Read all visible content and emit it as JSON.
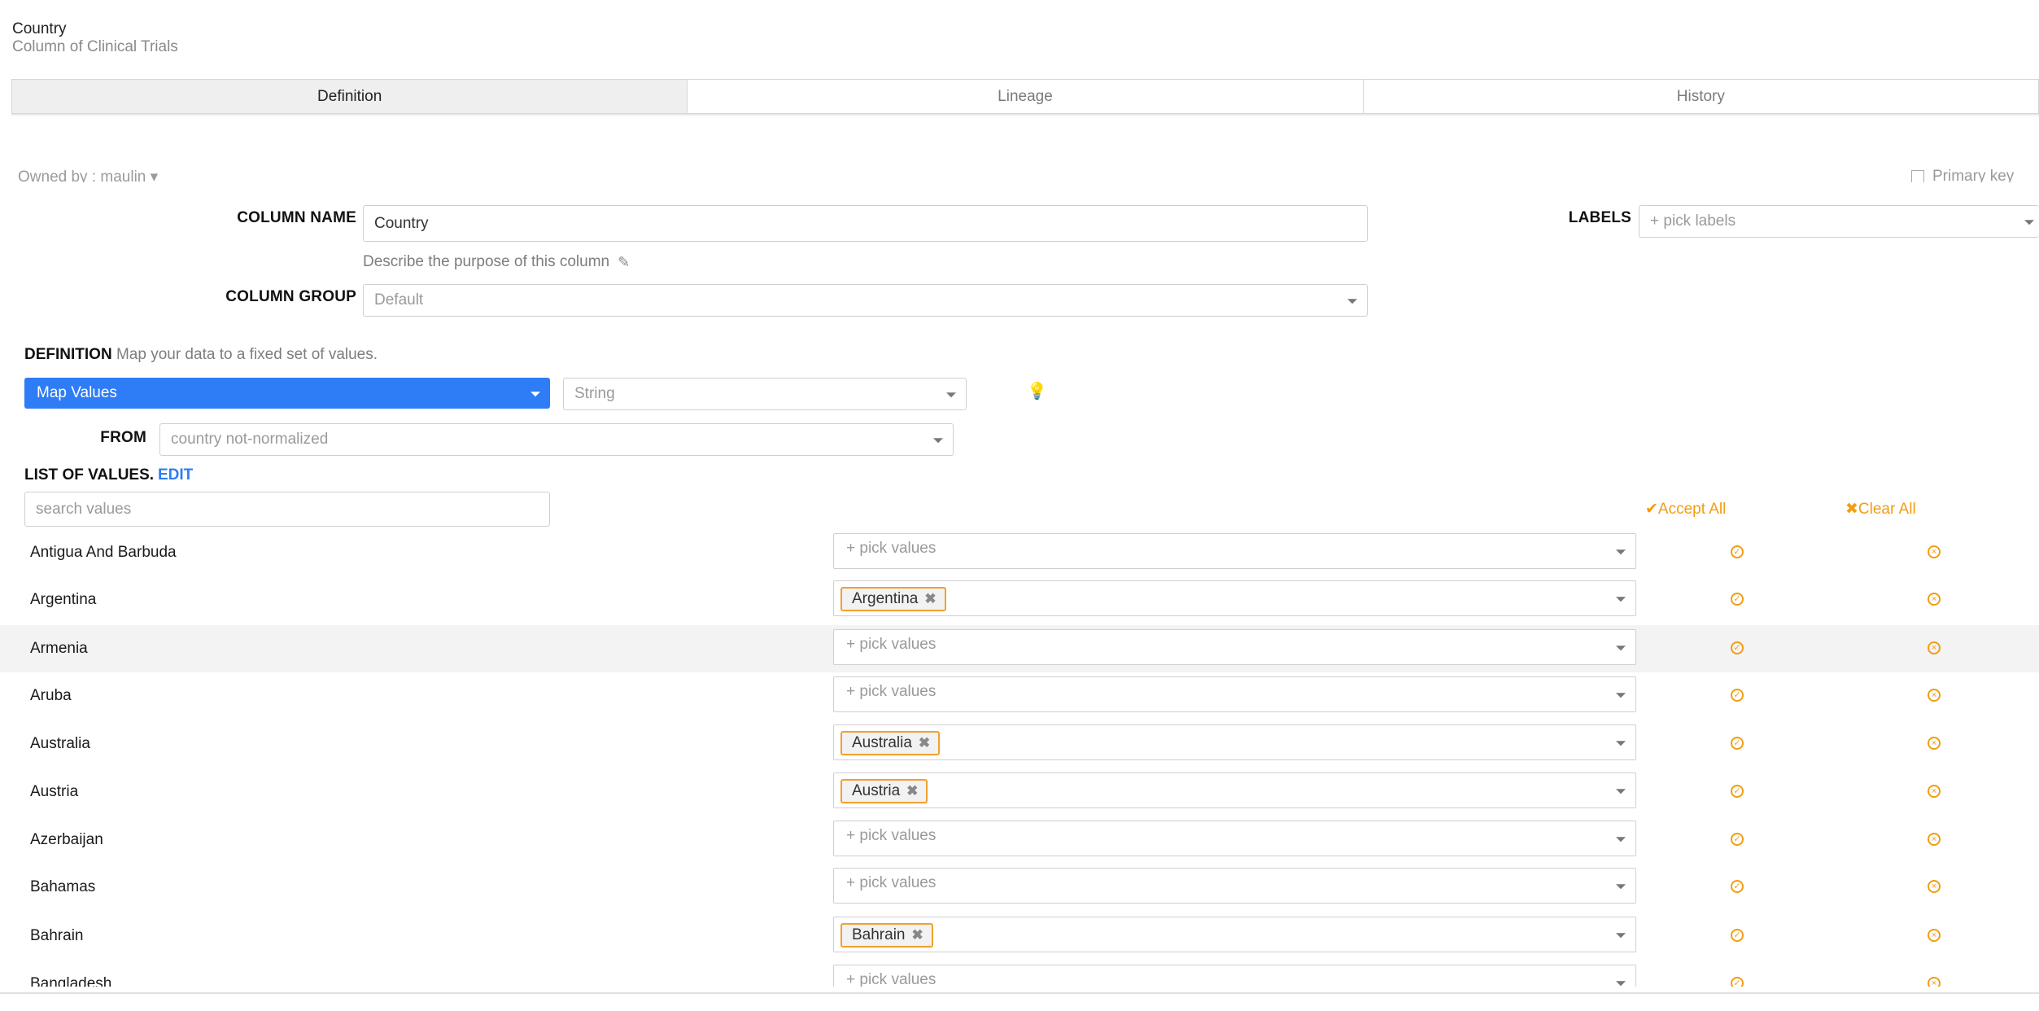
{
  "header": {
    "title": "Country",
    "subtitle": "Column of Clinical Trials"
  },
  "tabs": [
    "Definition",
    "Lineage",
    "History"
  ],
  "meta": {
    "owned_by": "Owned by : maulin ▾",
    "primary_key": "Primary key"
  },
  "form": {
    "column_name_label": "COLUMN NAME",
    "column_name_value": "Country",
    "describe_text": "Describe the purpose of this column",
    "column_group_label": "COLUMN GROUP",
    "column_group_value": "Default",
    "labels_label": "LABELS",
    "labels_placeholder": "+ pick labels"
  },
  "definition": {
    "heading": "DEFINITION",
    "hint": "Map your data to a fixed set of values.",
    "mode": "Map Values",
    "type": "String",
    "from_label": "FROM",
    "from_value": "country not-normalized"
  },
  "list_of_values": {
    "heading": "LIST OF VALUES.",
    "edit": "EDIT",
    "search_placeholder": "search values",
    "accept_all": "✔Accept All",
    "clear_all": "✖Clear All",
    "pick_placeholder": "+ pick values",
    "rows": [
      {
        "name": "Antigua And Barbuda",
        "mapped": ""
      },
      {
        "name": "Argentina",
        "mapped": "Argentina"
      },
      {
        "name": "Armenia",
        "mapped": ""
      },
      {
        "name": "Aruba",
        "mapped": ""
      },
      {
        "name": "Australia",
        "mapped": "Australia"
      },
      {
        "name": "Austria",
        "mapped": "Austria"
      },
      {
        "name": "Azerbaijan",
        "mapped": ""
      },
      {
        "name": "Bahamas",
        "mapped": ""
      },
      {
        "name": "Bahrain",
        "mapped": "Bahrain"
      },
      {
        "name": "Bangladesh",
        "mapped": ""
      }
    ]
  },
  "colors": {
    "accent": "#2e7cf6",
    "warning": "#f39c12"
  }
}
